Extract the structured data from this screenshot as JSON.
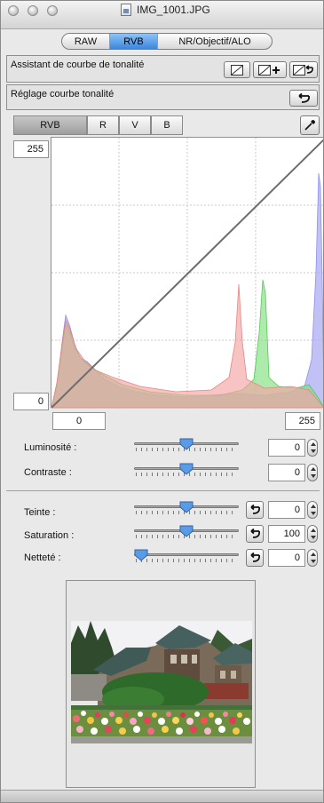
{
  "window": {
    "title": "IMG_1001.JPG"
  },
  "tabs": [
    {
      "label": "RAW",
      "active": false
    },
    {
      "label": "RVB",
      "active": true
    },
    {
      "label": "NR/Objectif/ALO",
      "active": false
    }
  ],
  "assistant": {
    "label": "Assistant de courbe de tonalité"
  },
  "curve_adjust": {
    "label": "Réglage courbe tonalité"
  },
  "channels": [
    {
      "label": "RVB",
      "active": true
    },
    {
      "label": "R",
      "active": false
    },
    {
      "label": "V",
      "active": false
    },
    {
      "label": "B",
      "active": false
    }
  ],
  "curve": {
    "input_min": "0",
    "input_max": "255",
    "output_max": "255",
    "output_min": "0"
  },
  "adjust_sliders": [
    {
      "label": "Luminosité :",
      "value": "0",
      "position": 0.5
    },
    {
      "label": "Contraste :",
      "value": "0",
      "position": 0.5
    }
  ],
  "color_sliders": [
    {
      "label": "Teinte :",
      "value": "0",
      "position": 0.5
    },
    {
      "label": "Saturation :",
      "value": "100",
      "position": 0.5
    },
    {
      "label": "Netteté :",
      "value": "0",
      "position": 0.0
    }
  ],
  "colors": {
    "accent": "#3c86dc",
    "thumb": "#5b9be6",
    "hist_red": "#f4a3a3",
    "hist_green": "#7fe07f",
    "hist_blue": "#a7a7f2"
  }
}
